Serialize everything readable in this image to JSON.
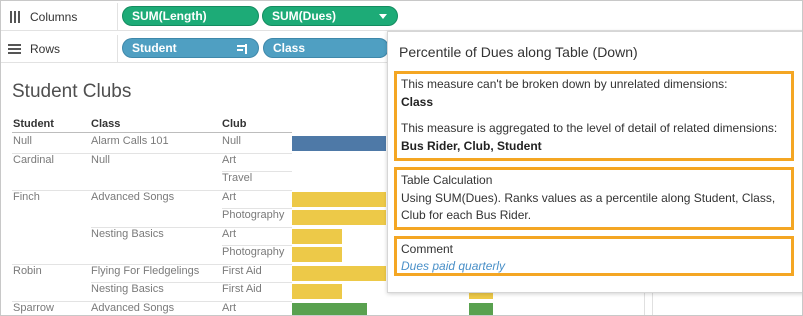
{
  "shelves": {
    "columns": {
      "label": "Columns",
      "pills": [
        "SUM(Length)",
        "SUM(Dues)"
      ]
    },
    "rows": {
      "label": "Rows",
      "pills": [
        "Student",
        "Class"
      ]
    }
  },
  "view": {
    "title": "Student Clubs",
    "headers": [
      "Student",
      "Class",
      "Club"
    ],
    "rows": [
      {
        "student": "Null",
        "class": "Alarm Calls 101",
        "club": "Null",
        "bar_fraction": 1.0,
        "bar_color": "blue"
      },
      {
        "student": "Cardinal",
        "class": "Null",
        "club": "Art",
        "bar_fraction": 0,
        "bar_color": ""
      },
      {
        "student": "",
        "class": "",
        "club": "Travel",
        "bar_fraction": 0,
        "bar_color": ""
      },
      {
        "student": "Finch",
        "class": "Advanced Songs",
        "club": "Art",
        "bar_fraction": 1.0,
        "bar_color": "yellow"
      },
      {
        "student": "",
        "class": "",
        "club": "Photography",
        "bar_fraction": 1.0,
        "bar_color": "yellow"
      },
      {
        "student": "",
        "class": "Nesting Basics",
        "club": "Art",
        "bar_fraction": 0.53,
        "bar_color": "yellow"
      },
      {
        "student": "",
        "class": "",
        "club": "Photography",
        "bar_fraction": 0.53,
        "bar_color": "yellow"
      },
      {
        "student": "Robin",
        "class": "Flying For Fledgelings",
        "club": "First Aid",
        "bar_fraction": 1.0,
        "bar_color": "yellow"
      },
      {
        "student": "",
        "class": "Nesting Basics",
        "club": "First Aid",
        "bar_fraction": 0.53,
        "bar_color": "yellow"
      },
      {
        "student": "Sparrow",
        "class": "Advanced Songs",
        "club": "Art",
        "bar_fraction": 0.8,
        "bar_color": "green"
      }
    ]
  },
  "tooltip": {
    "title": "Percentile of Dues along Table (Down)",
    "section1": {
      "line1": "This measure can't be broken down by unrelated dimensions:",
      "line1_bold": "Class",
      "line2": "This measure is aggregated to the level of detail of related dimensions:",
      "line2_bold": "Bus Rider, Club, Student"
    },
    "section2": {
      "heading": "Table Calculation",
      "line1": "Using SUM(Dues). Ranks values as a percentile along Student, Class,",
      "line2": "Club for each Bus Rider."
    },
    "section3": {
      "heading": "Comment",
      "text": "Dues paid quarterly"
    }
  },
  "colors": {
    "green_pill": "#1dab77",
    "blue_pill": "#4f9fc2",
    "highlight": "#f4a623",
    "bar_blue": "#4e79a7",
    "bar_yellow": "#edc948",
    "bar_green": "#59a14f"
  }
}
